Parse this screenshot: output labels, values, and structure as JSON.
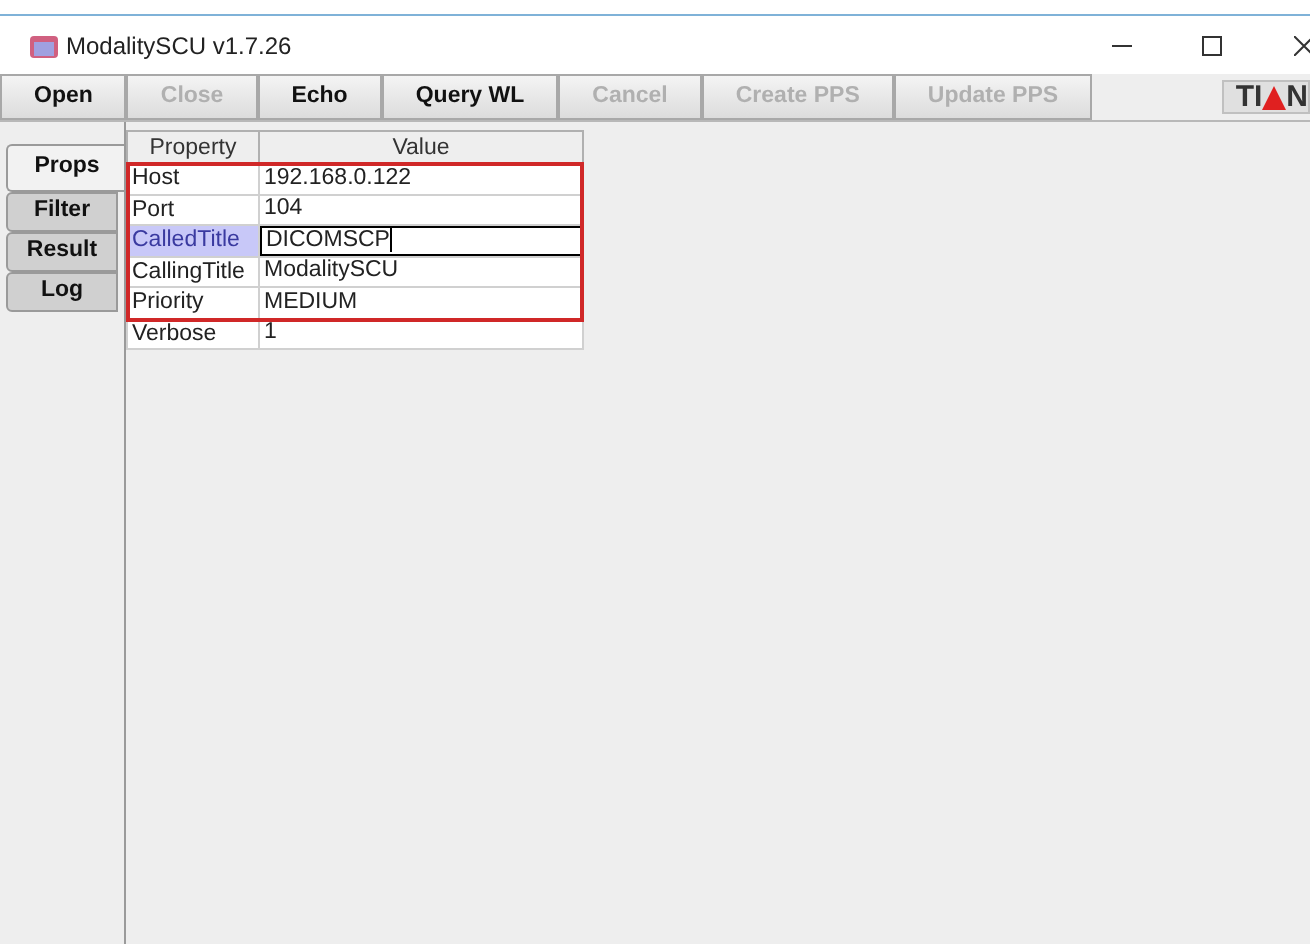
{
  "window": {
    "title": "ModalitySCU v1.7.26"
  },
  "toolbar": [
    {
      "label": "Open",
      "disabled": false
    },
    {
      "label": "Close",
      "disabled": true
    },
    {
      "label": "Echo",
      "disabled": false
    },
    {
      "label": "Query WL",
      "disabled": false
    },
    {
      "label": "Cancel",
      "disabled": true
    },
    {
      "label": "Create PPS",
      "disabled": true
    },
    {
      "label": "Update PPS",
      "disabled": true
    }
  ],
  "logo": {
    "left": "TI",
    "right": "N"
  },
  "tabs": [
    {
      "label": "Props",
      "selected": true
    },
    {
      "label": "Filter",
      "selected": false
    },
    {
      "label": "Result",
      "selected": false
    },
    {
      "label": "Log",
      "selected": false
    }
  ],
  "table": {
    "columns": [
      "Property",
      "Value"
    ],
    "rows": [
      {
        "property": "Host",
        "value": "192.168.0.122",
        "selected": false,
        "highlighted": true
      },
      {
        "property": "Port",
        "value": "104",
        "selected": false,
        "highlighted": true
      },
      {
        "property": "CalledTitle",
        "value": "DICOMSCP",
        "selected": true,
        "highlighted": true
      },
      {
        "property": "CallingTitle",
        "value": "ModalitySCU",
        "selected": false,
        "highlighted": true
      },
      {
        "property": "Priority",
        "value": "MEDIUM",
        "selected": false,
        "highlighted": true
      },
      {
        "property": "Verbose",
        "value": "1",
        "selected": false,
        "highlighted": false
      }
    ]
  }
}
